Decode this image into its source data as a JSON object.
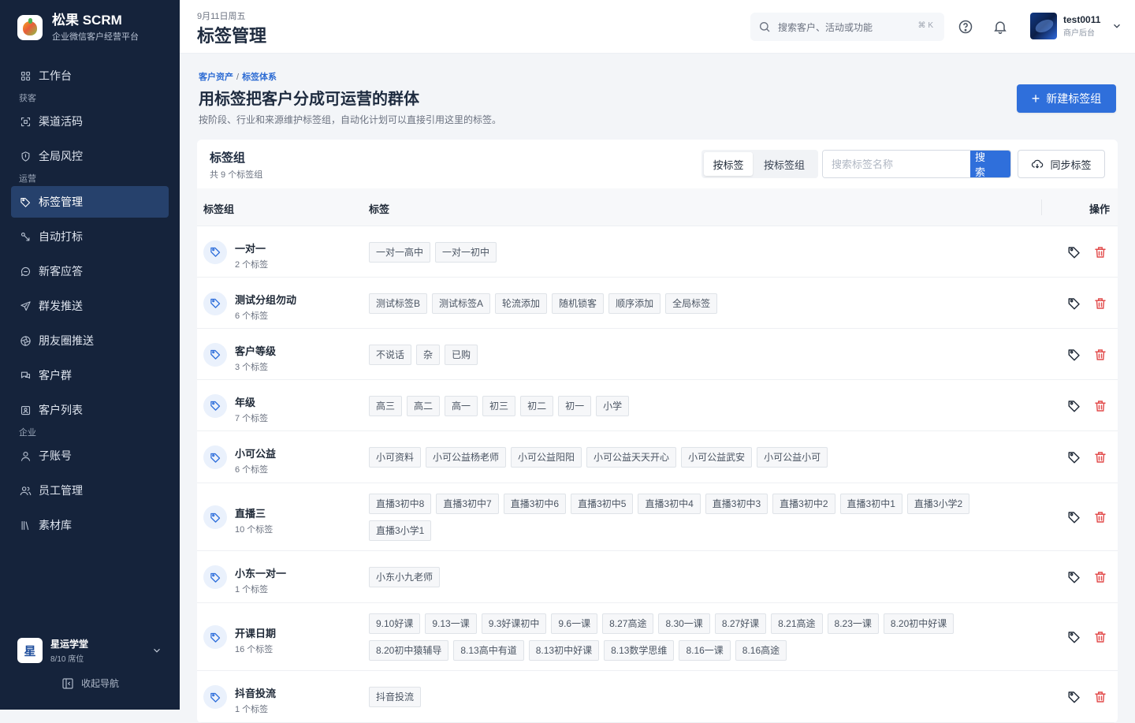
{
  "brand": {
    "name": "松果 SCRM",
    "subtitle": "企业微信客户经营平台"
  },
  "nav": {
    "items": [
      {
        "key": "workbench",
        "label": "工作台",
        "icon": "grid-icon"
      },
      {
        "group": "获客"
      },
      {
        "key": "channel",
        "label": "渠道活码",
        "icon": "qrcode-scan-icon"
      },
      {
        "key": "risk",
        "label": "全局风控",
        "icon": "shield-icon"
      },
      {
        "group": "运营"
      },
      {
        "key": "tags",
        "label": "标签管理",
        "icon": "tag-icon",
        "active": true
      },
      {
        "key": "autotag",
        "label": "自动打标",
        "icon": "auto-tag-icon"
      },
      {
        "key": "reply",
        "label": "新客应答",
        "icon": "chat-icon"
      },
      {
        "key": "mass",
        "label": "群发推送",
        "icon": "send-icon"
      },
      {
        "key": "moments",
        "label": "朋友圈推送",
        "icon": "aperture-icon"
      },
      {
        "key": "groups",
        "label": "客户群",
        "icon": "group-chat-icon"
      },
      {
        "key": "customers",
        "label": "客户列表",
        "icon": "contact-card-icon"
      },
      {
        "group": "企业"
      },
      {
        "key": "subaccount",
        "label": "子账号",
        "icon": "user-icon"
      },
      {
        "key": "staff",
        "label": "员工管理",
        "icon": "users-icon"
      },
      {
        "key": "materials",
        "label": "素材库",
        "icon": "library-icon"
      }
    ]
  },
  "org": {
    "avatar": "星",
    "name": "星运学堂",
    "seats": "8/10 席位"
  },
  "collapse_label": "收起导航",
  "header": {
    "date": "9月11日周五",
    "title": "标签管理",
    "search_placeholder": "搜索客户、活动或功能",
    "shortcut": "⌘ K",
    "user": {
      "name": "test0011",
      "role": "商户后台"
    }
  },
  "page": {
    "breadcrumb": [
      "客户资产",
      "标签体系"
    ],
    "breadcrumb_sep": "/",
    "headline": "用标签把客户分成可运营的群体",
    "description": "按阶段、行业和来源维护标签组，自动化计划可以直接引用这里的标签。",
    "new_button": "新建标签组"
  },
  "card": {
    "title": "标签组",
    "count": "共 9 个标签组",
    "seg_on": "按标签",
    "seg_off": "按标签组",
    "search_placeholder": "搜索标签名称",
    "search_button": "搜 索",
    "sync_button": "同步标签",
    "col_group": "标签组",
    "col_tags": "标签",
    "col_ops": "操作"
  },
  "rows": [
    {
      "name": "一对一",
      "count": "2 个标签",
      "tags": [
        "一对一高中",
        "一对一初中"
      ]
    },
    {
      "name": "测试分组勿动",
      "count": "6 个标签",
      "tags": [
        "测试标签B",
        "测试标签A",
        "轮流添加",
        "随机锁客",
        "顺序添加",
        "全局标签"
      ]
    },
    {
      "name": "客户等级",
      "count": "3 个标签",
      "tags": [
        "不说话",
        "杂",
        "已购"
      ]
    },
    {
      "name": "年级",
      "count": "7 个标签",
      "tags": [
        "高三",
        "高二",
        "高一",
        "初三",
        "初二",
        "初一",
        "小学"
      ]
    },
    {
      "name": "小可公益",
      "count": "6 个标签",
      "tags": [
        "小可资料",
        "小可公益杨老师",
        "小可公益阳阳",
        "小可公益天天开心",
        "小可公益武安",
        "小可公益小可"
      ]
    },
    {
      "name": "直播三",
      "count": "10 个标签",
      "tags": [
        "直播3初中8",
        "直播3初中7",
        "直播3初中6",
        "直播3初中5",
        "直播3初中4",
        "直播3初中3",
        "直播3初中2",
        "直播3初中1",
        "直播3小学2",
        "直播3小学1"
      ]
    },
    {
      "name": "小东一对一",
      "count": "1 个标签",
      "tags": [
        "小东小九老师"
      ]
    },
    {
      "name": "开课日期",
      "count": "16 个标签",
      "tags": [
        "9.10好课",
        "9.13一课",
        "9.3好课初中",
        "9.6一课",
        "8.27高途",
        "8.30一课",
        "8.27好课",
        "8.21高途",
        "8.23一课",
        "8.20初中好课",
        "8.20初中猿辅导",
        "8.13高中有道",
        "8.13初中好课",
        "8.13数学思维",
        "8.16一课",
        "8.16高途"
      ]
    },
    {
      "name": "抖音投流",
      "count": "1 个标签",
      "tags": [
        "抖音投流"
      ]
    }
  ]
}
